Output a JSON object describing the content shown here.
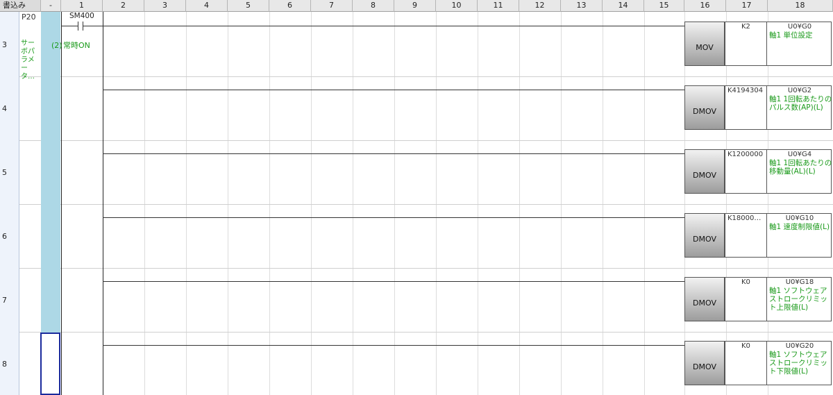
{
  "header": {
    "mode_label": "書込み",
    "dropdown_marker": "-",
    "columns": [
      "1",
      "2",
      "3",
      "4",
      "5",
      "6",
      "7",
      "8",
      "9",
      "10",
      "11",
      "12",
      "13",
      "14",
      "15",
      "16",
      "17",
      "18"
    ]
  },
  "pointer": {
    "label": "P20",
    "comment": "サーボパラメータ…"
  },
  "contact": {
    "device": "SM400",
    "symbol": "─┤├─",
    "comment_prefix": "(2)",
    "comment": "常時ON"
  },
  "rungs": [
    {
      "step": "3",
      "instr": "MOV",
      "operand1": "K2",
      "operand2": "U0¥G0",
      "comment": "軸1 単位設定"
    },
    {
      "step": "4",
      "instr": "DMOV",
      "operand1": "K4194304",
      "operand2": "U0¥G2",
      "comment": "軸1 1回転あたりのパルス数(AP)(L)"
    },
    {
      "step": "5",
      "instr": "DMOV",
      "operand1": "K1200000",
      "operand2": "U0¥G4",
      "comment": "軸1 1回転あたりの移動量(AL)(L)"
    },
    {
      "step": "6",
      "instr": "DMOV",
      "operand1": "K18000…",
      "operand2": "U0¥G10",
      "comment": "軸1 速度制限値(L)"
    },
    {
      "step": "7",
      "instr": "DMOV",
      "operand1": "K0",
      "operand2": "U0¥G18",
      "comment": "軸1 ソフトウェアストロークリミット上限値(L)"
    },
    {
      "step": "8",
      "instr": "DMOV",
      "operand1": "K0",
      "operand2": "U0¥G20",
      "comment": "軸1 ソフトウェアストロークリミット下限値(L)"
    }
  ],
  "colors": {
    "comment_green": "#1a9a1a",
    "column_blue": "#add8e6",
    "selection": "#1a2a9c"
  }
}
